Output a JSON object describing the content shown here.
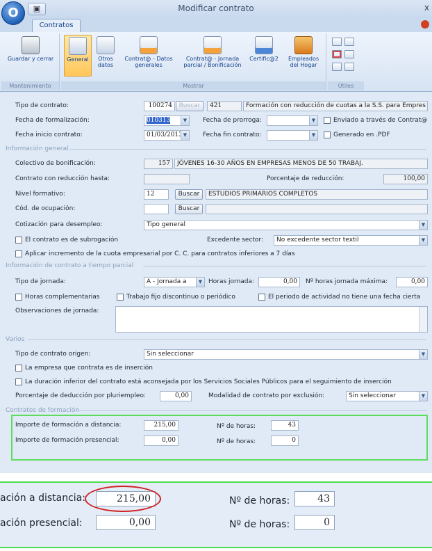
{
  "window": {
    "title": "Modificar contrato",
    "close_glyph": "x",
    "app_button_glyph": "O",
    "qat_glyph": "▣"
  },
  "ribbon": {
    "tab": "Contratos",
    "groups": {
      "mantenimiento": "Mantenimiento",
      "mostrar": "Mostrar",
      "utiles": "Útiles"
    },
    "buttons": {
      "guardar": "Guardar y cerrar",
      "general": "General",
      "otros": "Otros datos",
      "contrata_datos": "Contrat@ - Datos generales",
      "contrata_jornada": "Contrat@ - Jornada parcial / Bonificación",
      "certific": "Certific@2",
      "empleados": "Empleados del Hogar"
    }
  },
  "form": {
    "tipo_contrato": {
      "label": "Tipo de contrato:",
      "code": "100274",
      "button": "Buscar",
      "num": "421",
      "desc": "Formación con reducción de cuotas a la S.S. para Empres"
    },
    "fecha_formalizacion": {
      "label": "Fecha de formalización:",
      "value": "010313"
    },
    "fecha_prorroga": {
      "label": "Fecha de prorroga:",
      "value": ""
    },
    "enviado": "Enviado a través de Contrat@",
    "fecha_inicio": {
      "label": "Fecha inicio contrato:",
      "value": "01/03/2013"
    },
    "fecha_fin": {
      "label": "Fecha fin contrato:",
      "value": ""
    },
    "generado": "Generado en .PDF",
    "sec_info_general": "Información general",
    "colectivo": {
      "label": "Colectivo de bonificación:",
      "code": "157",
      "desc": "JÓVENES 16-30 AÑOS EN EMPRESAS MENOS DE 50 TRABAJ."
    },
    "contrato_reduccion": "Contrato con reducción hasta:",
    "porcentaje_reduccion": {
      "label": "Porcentaje de reducción:",
      "value": "100,00"
    },
    "nivel_formativo": {
      "label": "Nivel formativo:",
      "code": "12",
      "button": "Buscar",
      "desc": "ESTUDIOS PRIMARIOS COMPLETOS"
    },
    "cod_ocupacion": {
      "label": "Cód. de ocupación:",
      "button": "Buscar"
    },
    "cotizacion": {
      "label": "Cotización para desempleo:",
      "value": "Tipo general"
    },
    "subrogacion": "El contrato es de subrogación",
    "excedente": {
      "label": "Excedente sector:",
      "value": "No excedente sector textil"
    },
    "aplicar_incremento": "Aplicar incremento de la cuota empresarial por C. C. para contratos inferiores a 7 días",
    "sec_tiempo_parcial": "Información de contrato a tiempo parcial",
    "tipo_jornada": {
      "label": "Tipo de jornada:",
      "value": "A - Jornada a"
    },
    "horas_jornada": {
      "label": "Horas jornada:",
      "value": "0,00"
    },
    "horas_max": {
      "label": "Nº horas jornada máxima:",
      "value": "0,00"
    },
    "horas_complementarias": "Horas complementarias",
    "trabajo_fijo": "Trabajo fijo discontinuo o periódico",
    "periodo_actividad": "El periodo de actividad no tiene una fecha cierta",
    "observaciones": "Observaciones de jornada:",
    "sec_varios": "Varios",
    "tipo_origen": {
      "label": "Tipo de contrato origen:",
      "value": "Sin seleccionar"
    },
    "empresa_insercion": "La empresa que contrata es de inserción",
    "duracion_inferior": "La duración inferior del contrato está aconsejada por los Servicios Sociales Públicos para el seguimiento de inserción",
    "porcentaje_deduccion": {
      "label": "Porcentaje de deducción por pluriempleo:",
      "value": "0,00"
    },
    "modalidad": {
      "label": "Modalidad de contrato por exclusión:",
      "value": "Sin seleccionar"
    },
    "sec_formacion": "Contratos de formación",
    "importe_distancia": {
      "label": "Importe de formación a distancia:",
      "value": "215,00"
    },
    "horas_distancia": {
      "label": "Nº de horas:",
      "value": "43"
    },
    "importe_presencial": {
      "label": "Importe de formación presencial:",
      "value": "0,00"
    },
    "horas_presencial": {
      "label": "Nº de horas:",
      "value": "0"
    }
  },
  "zoom": {
    "label_distancia": "ación a distancia:",
    "value_distancia": "215,00",
    "label_horas1": "Nº de horas:",
    "value_horas1": "43",
    "label_presencial": "ación presencial:",
    "value_presencial": "0,00",
    "label_horas2": "Nº de horas:",
    "value_horas2": "0"
  },
  "icons": {
    "dropdown": "▼"
  }
}
